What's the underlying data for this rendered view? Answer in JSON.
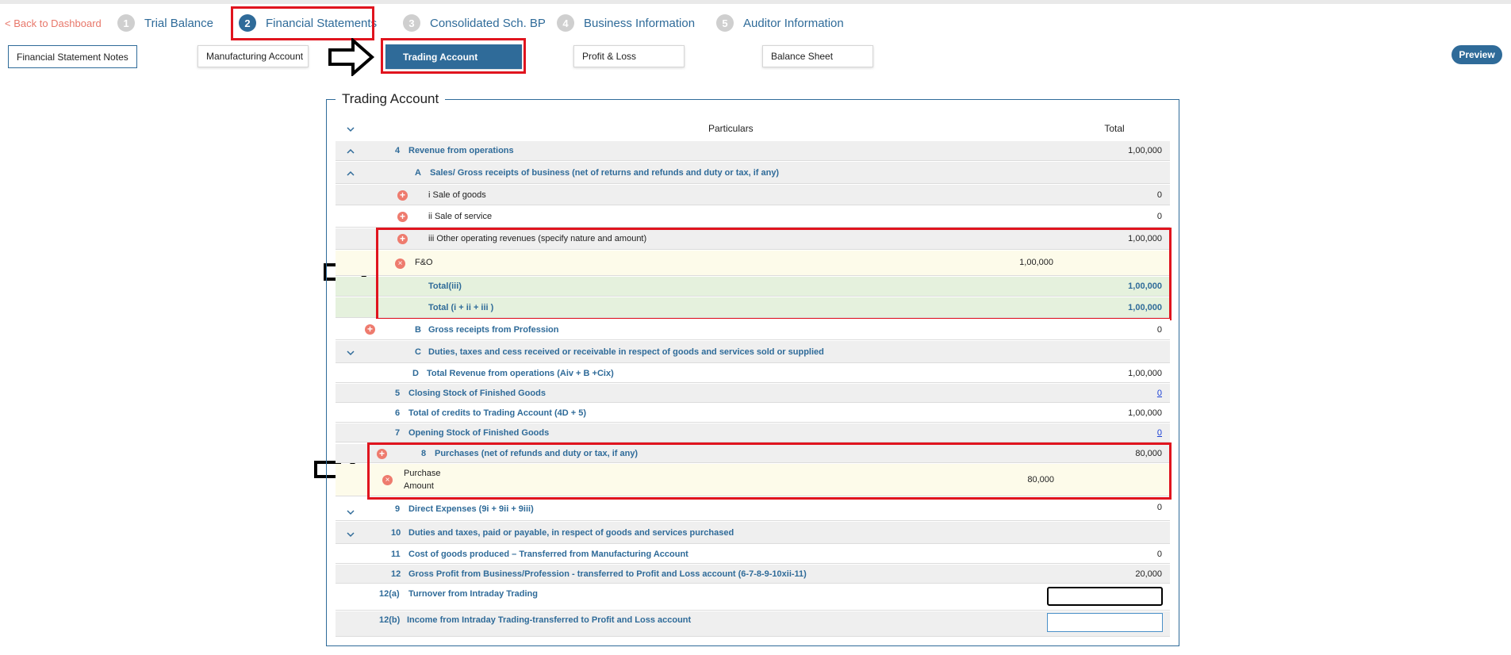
{
  "nav": {
    "back": "< Back to Dashboard",
    "steps": [
      {
        "num": "1",
        "label": "Trial Balance"
      },
      {
        "num": "2",
        "label": "Financial Statements"
      },
      {
        "num": "3",
        "label": "Consolidated Sch. BP"
      },
      {
        "num": "4",
        "label": "Business Information"
      },
      {
        "num": "5",
        "label": "Auditor Information"
      }
    ],
    "active_step": "2"
  },
  "subtabs": {
    "notes": "Financial Statement Notes",
    "manufacturing": "Manufacturing Account",
    "trading": "Trading Account",
    "pl": "Profit & Loss",
    "bs": "Balance Sheet",
    "active": "Trading Account"
  },
  "preview": "Preview",
  "panel": {
    "title": "Trading Account",
    "col_particulars": "Particulars",
    "col_total": "Total"
  },
  "rows": {
    "r4": {
      "num": "4",
      "label": "Revenue from operations",
      "total": "1,00,000"
    },
    "rA": {
      "num": "A",
      "label": "Sales/ Gross receipts of business (net of returns and refunds and duty or tax, if any)"
    },
    "ri": {
      "label": "i Sale of goods",
      "total": "0"
    },
    "rii": {
      "label": "ii Sale of service",
      "total": "0"
    },
    "riii": {
      "label": "iii Other operating revenues (specify nature and amount)",
      "total": "1,00,000"
    },
    "rfo": {
      "label": "F&O",
      "amount": "1,00,000"
    },
    "rtotiii": {
      "label": "Total(iii)",
      "total": "1,00,000"
    },
    "rtotall": {
      "label": "Total (i + ii + iii )",
      "total": "1,00,000"
    },
    "rB": {
      "num": "B",
      "label": "Gross receipts from Profession",
      "total": "0"
    },
    "rC": {
      "num": "C",
      "label": "Duties, taxes and cess received or receivable in respect of goods and services sold or supplied"
    },
    "rD": {
      "num": "D",
      "label": "Total Revenue from operations (Aiv + B +Cix)",
      "total": "1,00,000"
    },
    "r5": {
      "num": "5",
      "label": "Closing Stock of Finished Goods",
      "total": "0"
    },
    "r6": {
      "num": "6",
      "label": "Total of credits to Trading Account (4D + 5)",
      "total": "1,00,000"
    },
    "r7": {
      "num": "7",
      "label": "Opening Stock of Finished Goods",
      "total": "0"
    },
    "r8": {
      "num": "8",
      "label": "Purchases (net of refunds and duty or tax, if any)",
      "total": "80,000"
    },
    "rpur": {
      "label1": "Purchase",
      "label2": "Amount",
      "amount": "80,000"
    },
    "r9": {
      "num": "9",
      "label": "Direct Expenses (9i + 9ii + 9iii)",
      "total": "0"
    },
    "r10": {
      "num": "10",
      "label": "Duties and taxes, paid or payable, in respect of goods and services purchased"
    },
    "r11": {
      "num": "11",
      "label": "Cost of goods produced – Transferred from Manufacturing Account",
      "total": "0"
    },
    "r12": {
      "num": "12",
      "label": "Gross Profit from Business/Profession - transferred to Profit and Loss account (6-7-8-9-10xii-11)",
      "total": "20,000"
    },
    "r12a": {
      "num": "12(a)",
      "label": "Turnover from Intraday Trading",
      "input_value": ""
    },
    "r12b": {
      "num": "12(b)",
      "label": "Income from Intraday Trading-transferred to Profit and Loss account",
      "input_value": ""
    }
  },
  "colors": {
    "accent": "#2f6b99",
    "highlight": "#e0141e",
    "icon": "#ee7b6e"
  }
}
